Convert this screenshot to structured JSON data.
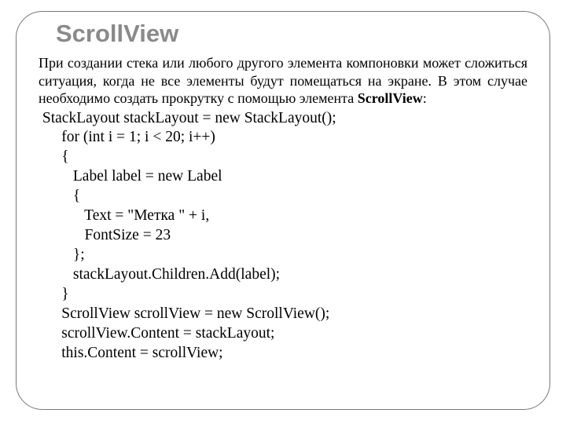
{
  "title": "ScrollView",
  "paragraph": {
    "line1": "При создании стека или любого другого элемента компоновки может сложиться ситуация, когда не все элементы будут помещаться на экране. В этом случае необходимо создать прокрутку с помощью элемента ",
    "strong": "ScrollView",
    "tail": ":"
  },
  "code": {
    "l1": " StackLayout stackLayout = new StackLayout();",
    "l2": "      for (int i = 1; i < 20; i++)",
    "l3": "      {",
    "l4": "         Label label = new Label",
    "l5": "         {",
    "l6": "            Text = \"Метка \" + i,",
    "l7": "            FontSize = 23",
    "l8": "         };",
    "l9": "         stackLayout.Children.Add(label);",
    "l10": "      }",
    "l11": "      ScrollView scrollView = new ScrollView();",
    "l12": "      scrollView.Content = stackLayout;",
    "l13": "      this.Content = scrollView;"
  }
}
